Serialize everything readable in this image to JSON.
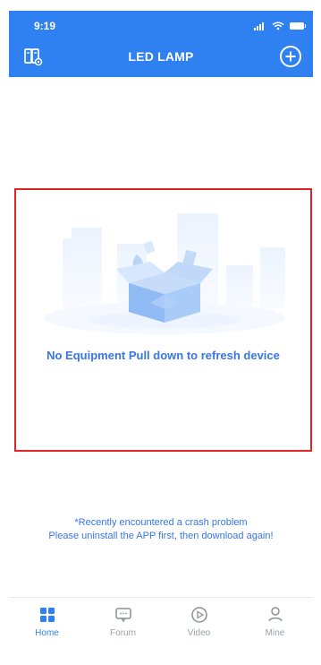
{
  "status": {
    "time": "9:19"
  },
  "header": {
    "title": "LED LAMP"
  },
  "empty_state": {
    "message": "No Equipment  Pull down to refresh device"
  },
  "notice": {
    "line1": "*Recently encountered a crash problem",
    "line2": "Please uninstall the APP first, then download again!"
  },
  "tabs": [
    {
      "label": "Home",
      "icon": "home-grid-icon",
      "active": true
    },
    {
      "label": "Forum",
      "icon": "forum-chat-icon",
      "active": false
    },
    {
      "label": "Video",
      "icon": "video-play-icon",
      "active": false
    },
    {
      "label": "Mine",
      "icon": "user-icon",
      "active": false
    }
  ],
  "colors": {
    "primary": "#2f80f0",
    "highlight_border": "#e02424",
    "message_text": "#3876e6",
    "inactive_tab": "#9aa0a6"
  }
}
